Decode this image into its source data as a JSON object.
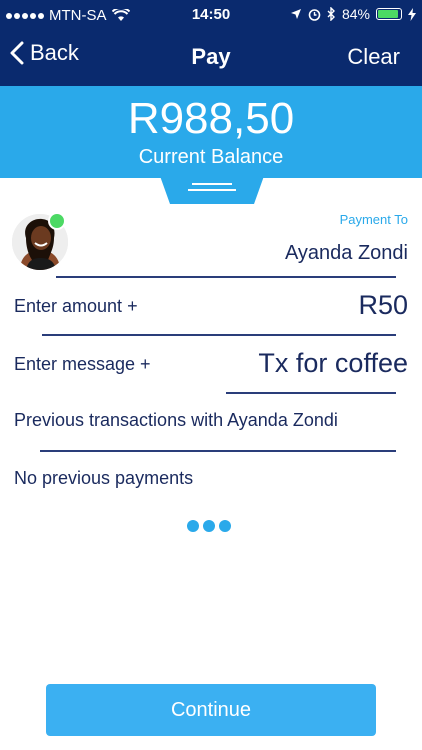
{
  "status_bar": {
    "carrier": "MTN-SA",
    "time": "14:50",
    "battery": "84%",
    "battery_level": 0.84
  },
  "nav": {
    "back_label": "Back",
    "title": "Pay",
    "clear_label": "Clear"
  },
  "balance": {
    "amount": "R988,50",
    "label": "Current Balance"
  },
  "recipient": {
    "payment_to_label": "Payment To",
    "name": "Ayanda Zondi"
  },
  "amount_row": {
    "label": "Enter amount +",
    "value": "R50"
  },
  "message_row": {
    "label": "Enter message +",
    "value": "Tx for coffee"
  },
  "history": {
    "heading": "Previous transactions with Ayanda Zondi",
    "empty_text": "No previous payments"
  },
  "continue_label": "Continue",
  "colors": {
    "navy": "#0a2a6e",
    "accent": "#2aa9ea",
    "online": "#4cd964"
  }
}
